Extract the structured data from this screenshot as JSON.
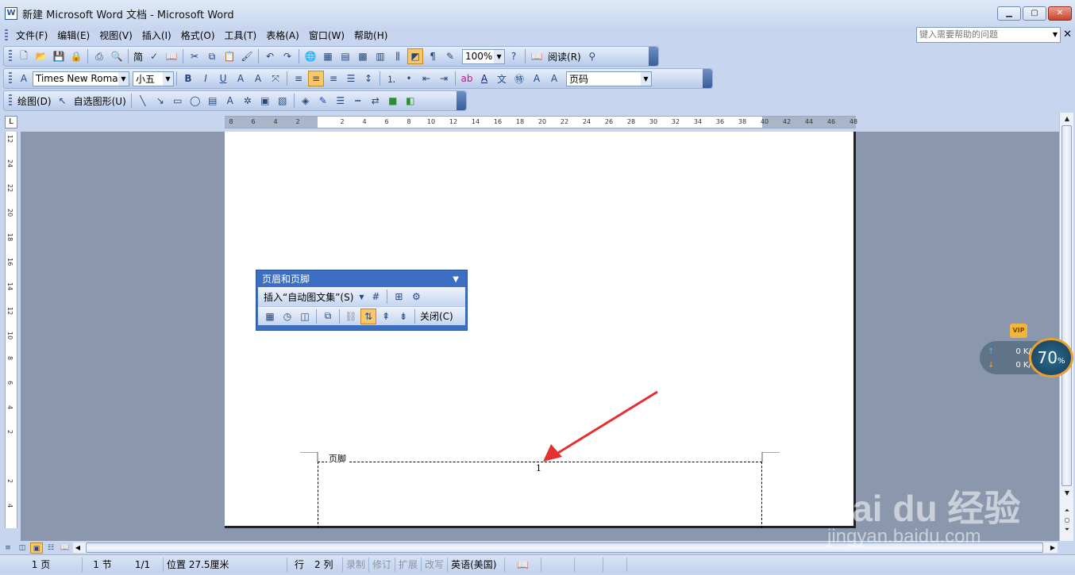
{
  "window": {
    "title": "新建 Microsoft Word 文档 - Microsoft Word",
    "icon_name": "word-doc-icon",
    "app_icon_text": "W"
  },
  "menu": {
    "items": [
      "文件(F)",
      "编辑(E)",
      "视图(V)",
      "插入(I)",
      "格式(O)",
      "工具(T)",
      "表格(A)",
      "窗口(W)",
      "帮助(H)"
    ],
    "help_placeholder": "键入需要帮助的问题"
  },
  "standard_toolbar": {
    "zoom": "100%",
    "read_label": "阅读(R)",
    "traditional_label": "简"
  },
  "formatting_toolbar": {
    "font": "Times New Roman",
    "size": "小五",
    "style": "页码"
  },
  "drawing_toolbar": {
    "draw_label": "绘图(D)",
    "autoshapes_label": "自选图形(U)"
  },
  "ruler": {
    "labels": [
      "8",
      "6",
      "4",
      "2",
      "",
      "2",
      "4",
      "6",
      "8",
      "10",
      "12",
      "14",
      "16",
      "18",
      "20",
      "22",
      "24",
      "26",
      "28",
      "30",
      "32",
      "34",
      "36",
      "38",
      "40",
      "42",
      "44",
      "46",
      "48"
    ],
    "vertical_labels": [
      "12",
      "24",
      "22",
      "20",
      "18",
      "16",
      "14",
      "12",
      "10",
      "8",
      "6",
      "4",
      "2",
      "",
      "2",
      "4"
    ],
    "corner": "L"
  },
  "document": {
    "footer_label": "页脚",
    "page_number": "1"
  },
  "header_footer_toolbar": {
    "title": "页眉和页脚",
    "insert_autotext": "插入“自动图文集”(S)",
    "close_label": "关闭(C)"
  },
  "status": {
    "page": "1 页",
    "section": "1 节",
    "page_of": "1/1",
    "position": "位置 27.5厘米",
    "line": "行",
    "column": "2 列",
    "rec": "录制",
    "trk": "修订",
    "ext": "扩展",
    "ovr": "改写",
    "language": "英语(美国)"
  },
  "net_widget": {
    "upload": "0 K/s",
    "download": "0 K/s",
    "percent": "70",
    "percent_unit": "%",
    "vip": "VIP"
  },
  "watermark": {
    "logo": "Bai du 经验",
    "url": "jingyan.baidu.com"
  },
  "colors": {
    "accent_blue": "#3c6fc4",
    "active_orange": "#f9c76a",
    "doc_background": "#8a97ad"
  }
}
